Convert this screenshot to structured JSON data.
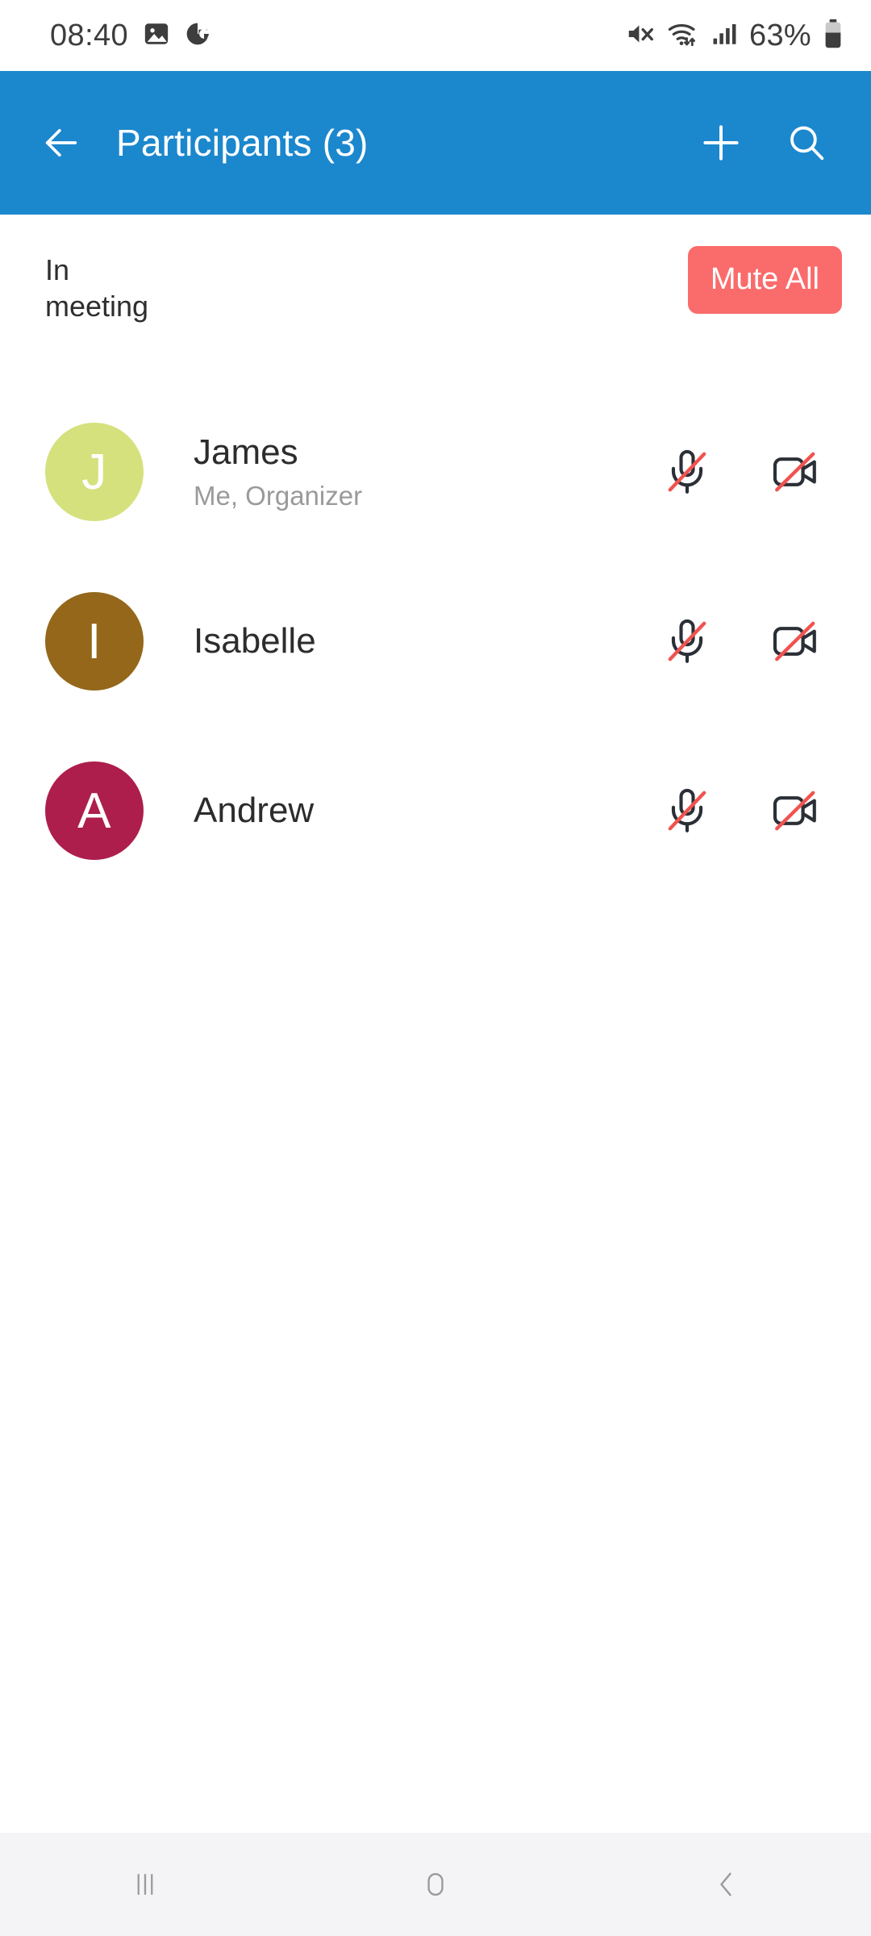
{
  "status_bar": {
    "time": "08:40",
    "battery_percent": "63%",
    "icons": [
      "gallery-icon",
      "app-badge-icon",
      "mute-volume-icon",
      "wifi-icon",
      "cellular-signal-icon",
      "battery-icon"
    ]
  },
  "app_bar": {
    "back_label": "back-arrow-icon",
    "title": "Participants (3)",
    "add_label": "add-participant-icon",
    "search_label": "search-icon",
    "background_color": "#1b87cd"
  },
  "section": {
    "label": "In meeting",
    "mute_all_label": "Mute All",
    "mute_all_color": "#fa6b6b"
  },
  "participants": [
    {
      "initial": "J",
      "name": "James",
      "subtitle": "Me, Organizer",
      "avatar_color": "#d5e17d",
      "mic_state": "muted",
      "camera_state": "off"
    },
    {
      "initial": "I",
      "name": "Isabelle",
      "subtitle": "",
      "avatar_color": "#94671a",
      "mic_state": "muted",
      "camera_state": "off"
    },
    {
      "initial": "A",
      "name": "Andrew",
      "subtitle": "",
      "avatar_color": "#ad1e4c",
      "mic_state": "muted",
      "camera_state": "off"
    }
  ],
  "nav_bar": {
    "recents_label": "recents-icon",
    "home_label": "home-icon",
    "back_label": "back-icon",
    "background_color": "#f4f4f7"
  },
  "colors": {
    "accent": "#1b87cd",
    "danger": "#fa6b6b",
    "strike": "#f0534f",
    "icon_dark": "#2b2f36"
  }
}
